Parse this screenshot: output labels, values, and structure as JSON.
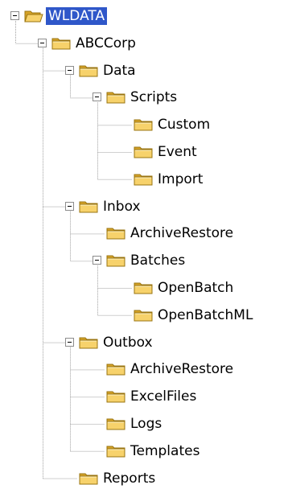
{
  "tree": {
    "nodes": [
      {
        "label": "WLDATA",
        "depth": 0,
        "expanded": true,
        "selected": true,
        "open_folder": true
      },
      {
        "label": "ABCCorp",
        "depth": 1,
        "expanded": true
      },
      {
        "label": "Data",
        "depth": 2,
        "expanded": true
      },
      {
        "label": "Scripts",
        "depth": 3,
        "expanded": true
      },
      {
        "label": "Custom",
        "depth": 4
      },
      {
        "label": "Event",
        "depth": 4
      },
      {
        "label": "Import",
        "depth": 4
      },
      {
        "label": "Inbox",
        "depth": 2,
        "expanded": true
      },
      {
        "label": "ArchiveRestore",
        "depth": 3
      },
      {
        "label": "Batches",
        "depth": 3,
        "expanded": true
      },
      {
        "label": "OpenBatch",
        "depth": 4
      },
      {
        "label": "OpenBatchML",
        "depth": 4
      },
      {
        "label": "Outbox",
        "depth": 2,
        "expanded": true
      },
      {
        "label": "ArchiveRestore",
        "depth": 3
      },
      {
        "label": "ExcelFiles",
        "depth": 3
      },
      {
        "label": "Logs",
        "depth": 3
      },
      {
        "label": "Templates",
        "depth": 3
      },
      {
        "label": "Reports",
        "depth": 2
      }
    ]
  },
  "colors": {
    "selection": "#2f57c9",
    "tree_line": "#a0a0a0",
    "folder_fill": "#f7d26b",
    "folder_dark": "#d6a328"
  }
}
